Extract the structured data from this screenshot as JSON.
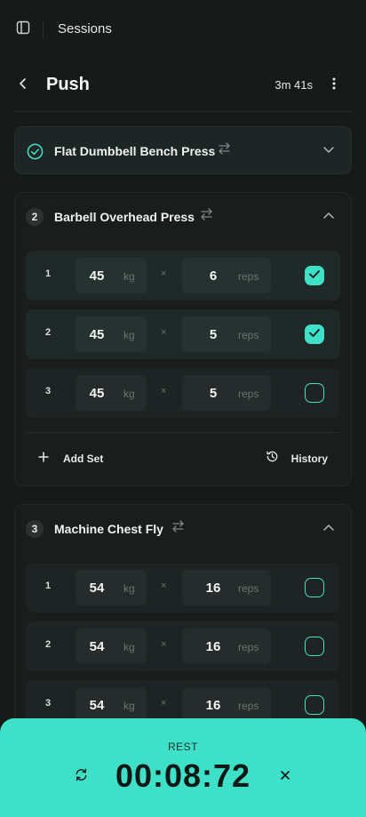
{
  "topbar": {
    "title": "Sessions"
  },
  "workout": {
    "title": "Push",
    "elapsed": "3m 41s"
  },
  "exercises": [
    {
      "name": "Flat Dumbbell Bench Press",
      "completed": true,
      "expanded": false
    },
    {
      "number": "2",
      "name": "Barbell Overhead Press",
      "expanded": true,
      "sets": [
        {
          "num": "1",
          "weight": "45",
          "weight_unit": "kg",
          "times": "×",
          "reps": "6",
          "reps_unit": "reps",
          "done": true
        },
        {
          "num": "2",
          "weight": "45",
          "weight_unit": "kg",
          "times": "×",
          "reps": "5",
          "reps_unit": "reps",
          "done": true
        },
        {
          "num": "3",
          "weight": "45",
          "weight_unit": "kg",
          "times": "×",
          "reps": "5",
          "reps_unit": "reps",
          "done": false
        }
      ],
      "add_set_label": "Add Set",
      "history_label": "History"
    },
    {
      "number": "3",
      "name": "Machine Chest Fly",
      "expanded": true,
      "sets": [
        {
          "num": "1",
          "weight": "54",
          "weight_unit": "kg",
          "times": "×",
          "reps": "16",
          "reps_unit": "reps",
          "done": false
        },
        {
          "num": "2",
          "weight": "54",
          "weight_unit": "kg",
          "times": "×",
          "reps": "16",
          "reps_unit": "reps",
          "done": false
        },
        {
          "num": "3",
          "weight": "54",
          "weight_unit": "kg",
          "times": "×",
          "reps": "16",
          "reps_unit": "reps",
          "done": false
        }
      ]
    }
  ],
  "rest_timer": {
    "label": "REST",
    "time": "00:08:72"
  },
  "colors": {
    "accent": "#3fe0c8",
    "background": "#161a19",
    "card": "#191e1d"
  },
  "icons": [
    "sidebar-icon",
    "chevron-left-icon",
    "more-vertical-icon",
    "check-circle-icon",
    "swap-icon",
    "chevron-down-icon",
    "chevron-up-icon",
    "check-icon",
    "plus-icon",
    "history-icon",
    "refresh-icon",
    "close-icon"
  ]
}
